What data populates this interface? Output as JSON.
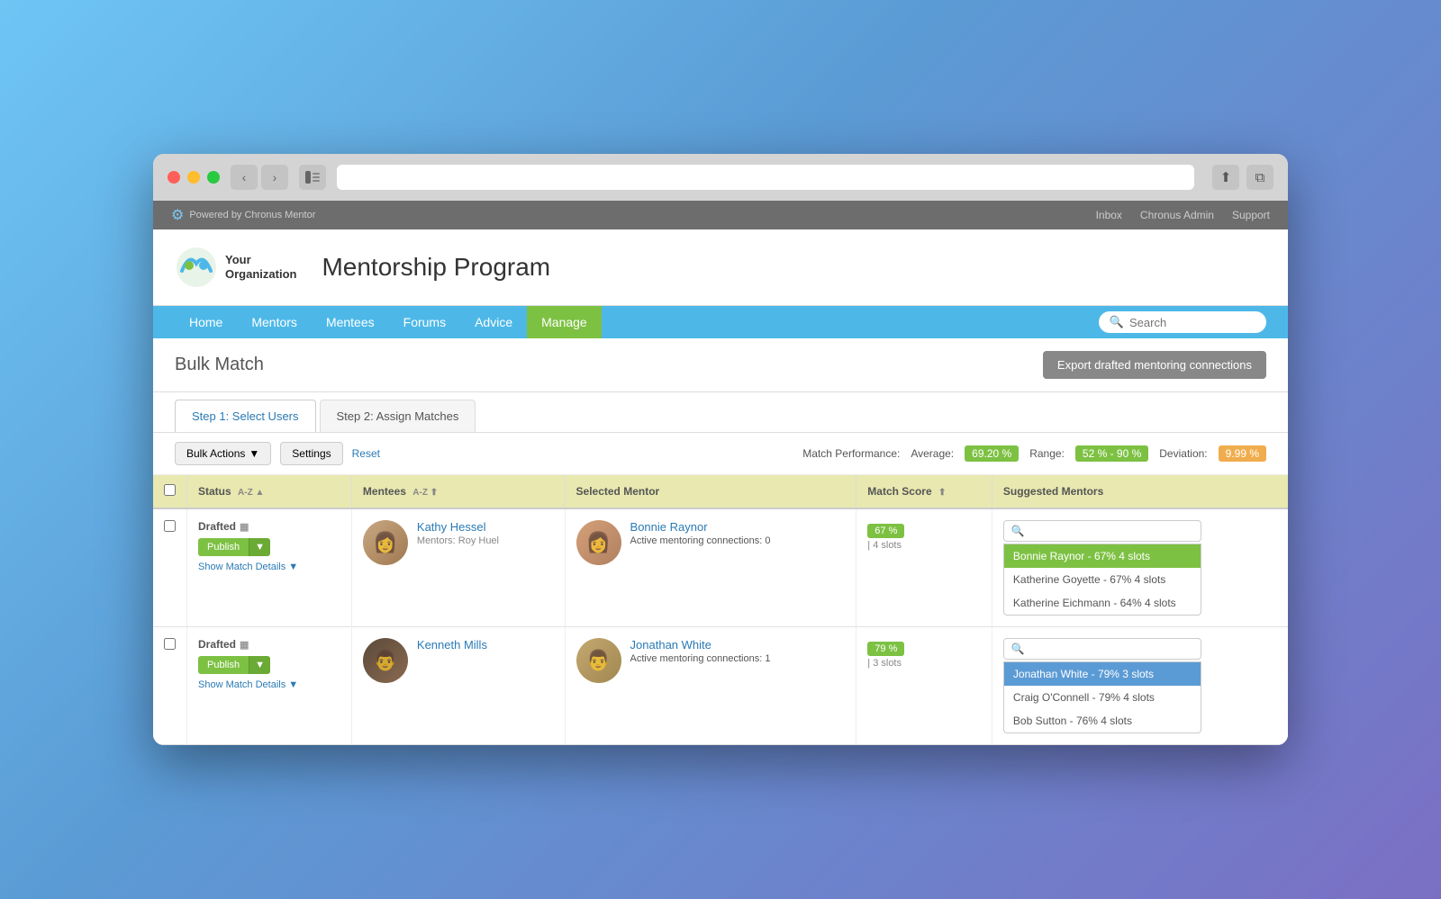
{
  "browser": {
    "url": ""
  },
  "topbar": {
    "powered_by": "Powered by Chronus Mentor",
    "links": [
      "Inbox",
      "Chronus Admin",
      "Support"
    ]
  },
  "header": {
    "org_name": "Your\nOrganization",
    "program_name": "Mentorship Program"
  },
  "nav": {
    "items": [
      "Home",
      "Mentors",
      "Mentees",
      "Forums",
      "Advice",
      "Manage"
    ],
    "active": "Manage",
    "search_placeholder": "Search"
  },
  "page": {
    "title": "Bulk Match",
    "export_btn": "Export drafted mentoring connections"
  },
  "tabs": [
    {
      "label": "Step 1: Select Users",
      "active": true
    },
    {
      "label": "Step 2: Assign Matches",
      "active": false
    }
  ],
  "controls": {
    "bulk_actions": "Bulk Actions",
    "settings": "Settings",
    "reset": "Reset",
    "match_performance": "Match Performance:",
    "average_label": "Average:",
    "average_value": "69.20 %",
    "range_label": "Range:",
    "range_value": "52 % - 90 %",
    "deviation_label": "Deviation:",
    "deviation_value": "9.99 %"
  },
  "table": {
    "columns": [
      "",
      "Status",
      "Mentees",
      "",
      "Selected Mentor",
      "Match Score",
      "Suggested Mentors"
    ],
    "rows": [
      {
        "status": "Drafted",
        "publish_label": "Publish",
        "show_details": "Show Match Details",
        "mentee_name": "Kathy Hessel",
        "mentee_sub": "Mentors: Roy Huel",
        "mentee_avatar": "kathy",
        "mentor_name": "Bonnie Raynor",
        "mentor_sub": "Active mentoring connections: 0",
        "mentor_score": "67 %",
        "mentor_slots": "4 slots",
        "mentor_avatar": "bonnie",
        "suggestions": [
          {
            "text": "Bonnie Raynor - 67% 4 slots",
            "selected": true
          },
          {
            "text": "Katherine Goyette - 67% 4 slots",
            "selected": false
          },
          {
            "text": "Katherine Eichmann - 64% 4 slots",
            "selected": false
          }
        ]
      },
      {
        "status": "Drafted",
        "publish_label": "Publish",
        "show_details": "Show Match Details",
        "mentee_name": "Kenneth Mills",
        "mentee_sub": "",
        "mentee_avatar": "kenneth",
        "mentor_name": "Jonathan White",
        "mentor_sub": "Active mentoring connections: 1",
        "mentor_score": "79 %",
        "mentor_slots": "3 slots",
        "mentor_avatar": "jonathan",
        "suggestions": [
          {
            "text": "Jonathan White - 79% 3 slots",
            "selected": true
          },
          {
            "text": "Craig O'Connell - 79% 4 slots",
            "selected": false
          },
          {
            "text": "Bob Sutton - 76% 4 slots",
            "selected": false
          }
        ]
      }
    ]
  }
}
